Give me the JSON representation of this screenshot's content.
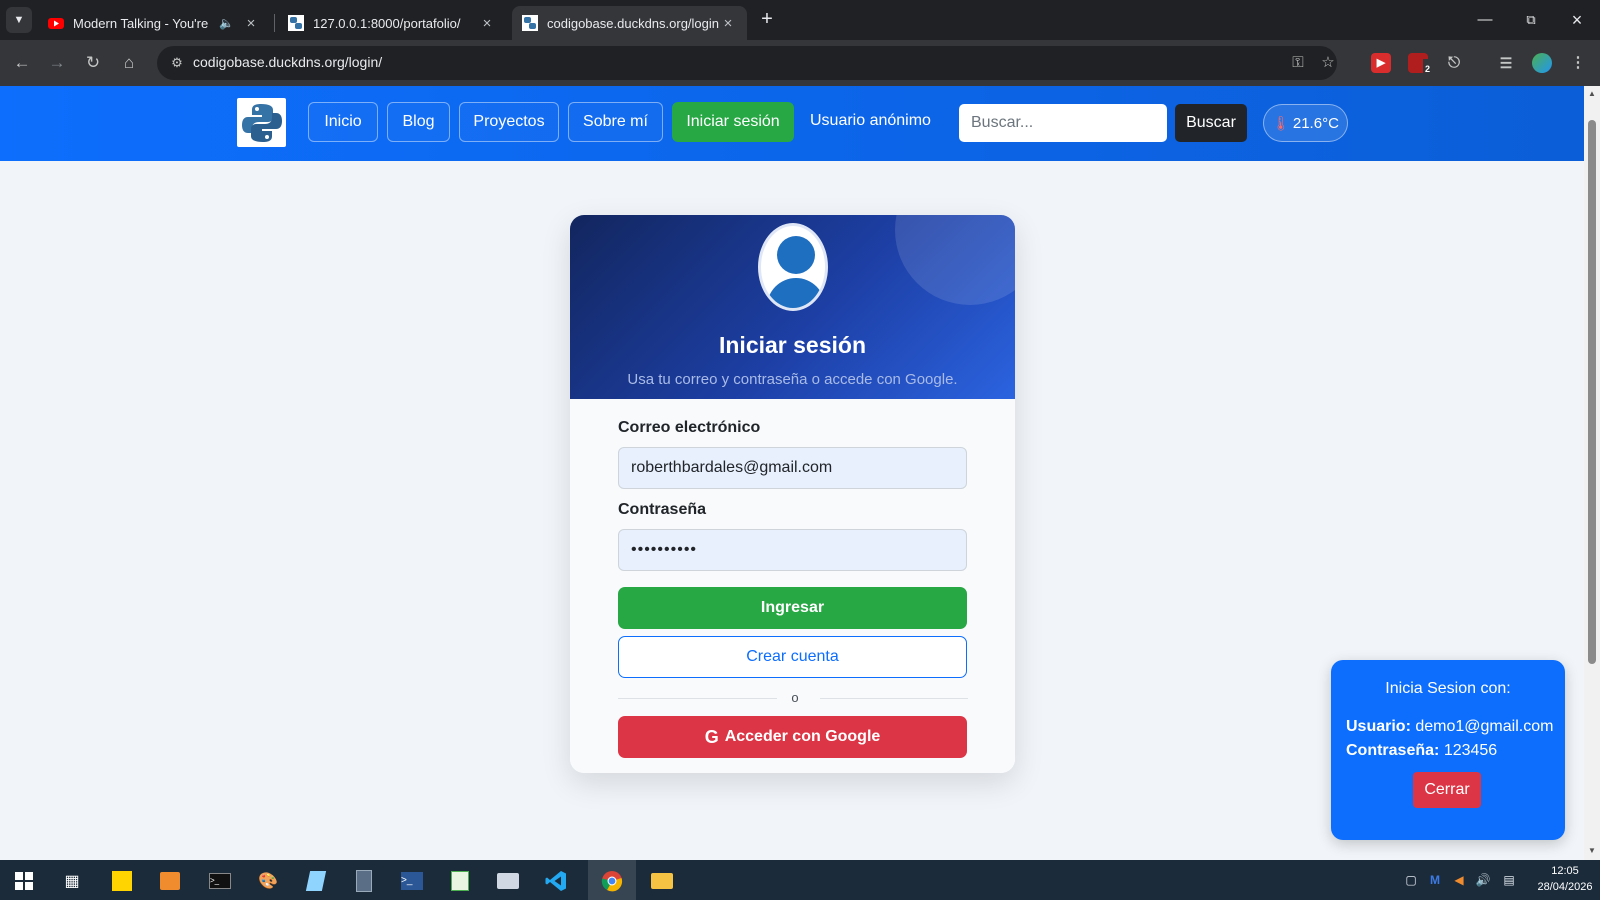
{
  "browser": {
    "tabs": [
      {
        "title": "Modern Talking - You're My",
        "active": false
      },
      {
        "title": "127.0.0.1:8000/portafolio/",
        "active": false
      },
      {
        "title": "codigobase.duckdns.org/login/",
        "active": true
      }
    ],
    "url": "codigobase.duckdns.org/login/",
    "extension_badge": "2"
  },
  "navbar": {
    "links": [
      "Inicio",
      "Blog",
      "Proyectos",
      "Sobre mí"
    ],
    "login": "Iniciar sesión",
    "user": "Usuario anónimo",
    "search_placeholder": "Buscar...",
    "search_button": "Buscar",
    "temperature": "21.6°C"
  },
  "login_card": {
    "title": "Iniciar sesión",
    "subtitle": "Usa tu correo y contraseña o accede con Google.",
    "email_label": "Correo electrónico",
    "email_value": "roberthbardales@gmail.com",
    "password_label": "Contraseña",
    "password_value": "••••••••••",
    "submit": "Ingresar",
    "create_account": "Crear cuenta",
    "divider": "o",
    "google": "Acceder con Google"
  },
  "popup": {
    "title": "Inicia Sesion con:",
    "user_label": "Usuario:",
    "user_value": "demo1@gmail.com",
    "pass_label": "Contraseña:",
    "pass_value": "123456",
    "close": "Cerrar"
  },
  "taskbar": {
    "time": "12:05",
    "date": "28/04/2026"
  },
  "colors": {
    "navbar": "#0d6efd",
    "success": "#28a745",
    "danger": "#dc3545",
    "card_header": "#1d3fa5"
  }
}
